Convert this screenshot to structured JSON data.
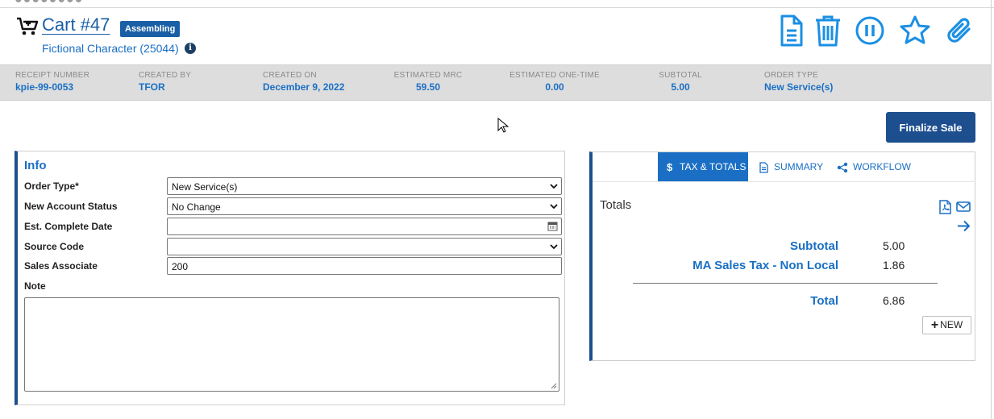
{
  "header": {
    "cart_title": "Cart #47",
    "status": "Assembling",
    "customer": "Fictional Character (25044)"
  },
  "actions": [
    "document-icon",
    "trash-icon",
    "pause-icon",
    "star-icon",
    "paperclip-icon"
  ],
  "meta": [
    {
      "label": "RECEIPT NUMBER",
      "value": "kpie-99-0053"
    },
    {
      "label": "CREATED BY",
      "value": "TFOR"
    },
    {
      "label": "CREATED ON",
      "value": "December 9, 2022"
    },
    {
      "label": "ESTIMATED MRC",
      "value": "59.50"
    },
    {
      "label": "ESTIMATED ONE-TIME",
      "value": "0.00"
    },
    {
      "label": "SUBTOTAL",
      "value": "5.00"
    },
    {
      "label": "ORDER TYPE",
      "value": "New Service(s)"
    }
  ],
  "finalize_label": "Finalize Sale",
  "info": {
    "title": "Info",
    "fields": [
      {
        "label": "Order Type*",
        "value": "New Service(s)"
      },
      {
        "label": "New Account Status",
        "value": "No Change"
      },
      {
        "label": "Est. Complete Date",
        "value": ""
      },
      {
        "label": "Source Code",
        "value": ""
      },
      {
        "label": "Sales Associate",
        "value": "200"
      }
    ],
    "note_label": "Note"
  },
  "tabs": [
    {
      "label": "TAX & TOTALS",
      "active": true
    },
    {
      "label": "SUMMARY"
    },
    {
      "label": "WORKFLOW"
    }
  ],
  "totals": {
    "heading": "Totals",
    "rows": [
      {
        "label": "Subtotal",
        "value": "5.00"
      },
      {
        "label": "MA Sales Tax - Non Local",
        "value": "1.86"
      },
      {
        "label": "Total",
        "value": "6.86"
      }
    ],
    "new_label": "NEW"
  },
  "colors": {
    "accent": "#1a6fc4",
    "dark_accent": "#1d4f8f"
  }
}
